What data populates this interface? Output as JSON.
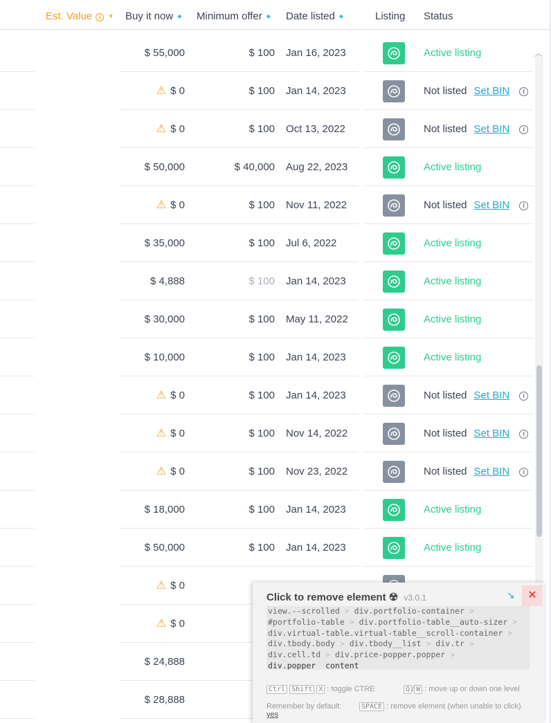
{
  "header": {
    "est_value": "Est. Value",
    "buy_it_now": "Buy it now",
    "minimum_offer": "Minimum offer",
    "date_listed": "Date listed",
    "listing": "Listing",
    "status": "Status"
  },
  "rows": [
    {
      "bin": "$ 55,000",
      "bin_warning": false,
      "min_offer": "$ 100",
      "min_offer_muted": false,
      "date": "Jan 16, 2023",
      "listed": true,
      "status": "Active listing"
    },
    {
      "bin": "$ 0",
      "bin_warning": true,
      "min_offer": "$ 100",
      "min_offer_muted": false,
      "date": "Jan 14, 2023",
      "listed": false,
      "status": "Not listed",
      "action": "Set BIN"
    },
    {
      "bin": "$ 0",
      "bin_warning": true,
      "min_offer": "$ 100",
      "min_offer_muted": false,
      "date": "Oct 13, 2022",
      "listed": false,
      "status": "Not listed",
      "action": "Set BIN"
    },
    {
      "bin": "$ 50,000",
      "bin_warning": false,
      "min_offer": "$ 40,000",
      "min_offer_muted": false,
      "date": "Aug 22, 2023",
      "listed": true,
      "status": "Active listing"
    },
    {
      "bin": "$ 0",
      "bin_warning": true,
      "min_offer": "$ 100",
      "min_offer_muted": false,
      "date": "Nov 11, 2022",
      "listed": false,
      "status": "Not listed",
      "action": "Set BIN"
    },
    {
      "bin": "$ 35,000",
      "bin_warning": false,
      "min_offer": "$ 100",
      "min_offer_muted": false,
      "date": "Jul 6, 2022",
      "listed": true,
      "status": "Active listing"
    },
    {
      "bin": "$ 4,888",
      "bin_warning": false,
      "min_offer": "$ 100",
      "min_offer_muted": true,
      "date": "Jan 14, 2023",
      "listed": true,
      "status": "Active listing"
    },
    {
      "bin": "$ 30,000",
      "bin_warning": false,
      "min_offer": "$ 100",
      "min_offer_muted": false,
      "date": "May 11, 2022",
      "listed": true,
      "status": "Active listing"
    },
    {
      "bin": "$ 10,000",
      "bin_warning": false,
      "min_offer": "$ 100",
      "min_offer_muted": false,
      "date": "Jan 14, 2023",
      "listed": true,
      "status": "Active listing"
    },
    {
      "bin": "$ 0",
      "bin_warning": true,
      "min_offer": "$ 100",
      "min_offer_muted": false,
      "date": "Jan 14, 2023",
      "listed": false,
      "status": "Not listed",
      "action": "Set BIN"
    },
    {
      "bin": "$ 0",
      "bin_warning": true,
      "min_offer": "$ 100",
      "min_offer_muted": false,
      "date": "Nov 14, 2022",
      "listed": false,
      "status": "Not listed",
      "action": "Set BIN"
    },
    {
      "bin": "$ 0",
      "bin_warning": true,
      "min_offer": "$ 100",
      "min_offer_muted": false,
      "date": "Nov 23, 2022",
      "listed": false,
      "status": "Not listed",
      "action": "Set BIN"
    },
    {
      "bin": "$ 18,000",
      "bin_warning": false,
      "min_offer": "$ 100",
      "min_offer_muted": false,
      "date": "Jan 14, 2023",
      "listed": true,
      "status": "Active listing"
    },
    {
      "bin": "$ 50,000",
      "bin_warning": false,
      "min_offer": "$ 100",
      "min_offer_muted": false,
      "date": "Jan 14, 2023",
      "listed": true,
      "status": "Active listing"
    },
    {
      "bin": "$ 0",
      "bin_warning": true,
      "listed": false
    },
    {
      "bin": "$ 0",
      "bin_warning": true
    },
    {
      "bin": "$ 24,888",
      "bin_warning": false
    },
    {
      "bin": "$ 28,888",
      "bin_warning": false
    }
  ],
  "overlay": {
    "title": "Click to remove element",
    "icon": "☢",
    "version": "v3.0.1",
    "close": "✕",
    "arrow": "↘",
    "path_lines": [
      [
        "view.--scrolled",
        "div.portfolio-container"
      ],
      [
        "#portfolio-table",
        "div.portfolio-table__auto-sizer"
      ],
      [
        "div.virtual-table.virtual-table__scroll-container"
      ],
      [
        "div.tbody.body",
        "div.tbody__list",
        "div.tr"
      ],
      [
        "div.cell.td",
        "div.price-popper.popper"
      ]
    ],
    "path_last": "div.popper__content",
    "separator": ">",
    "keys_toggle": [
      "Ctrl",
      "Shift",
      "X"
    ],
    "toggle_text": ": toggle CTRE",
    "keys_move": [
      "Q",
      "W"
    ],
    "move_slash": "/",
    "move_text": ": move up or down one level",
    "remember_text": "Remember by default:",
    "remember_value": "yes",
    "key_space": "SPACE",
    "space_text": ": remove element (when unable to click)"
  },
  "colors": {
    "active_green": "#2ecc8c",
    "inactive_gray": "#8691a0",
    "warning_orange": "#f0a219",
    "link_blue": "#26a7cc",
    "sort_accent": "#f0a219"
  },
  "icons": {
    "sort": "sort-icon",
    "info": "info-icon",
    "warning": "warning-icon",
    "listing": "listing-logo-icon",
    "chevron_up": "chevron-up-icon"
  }
}
